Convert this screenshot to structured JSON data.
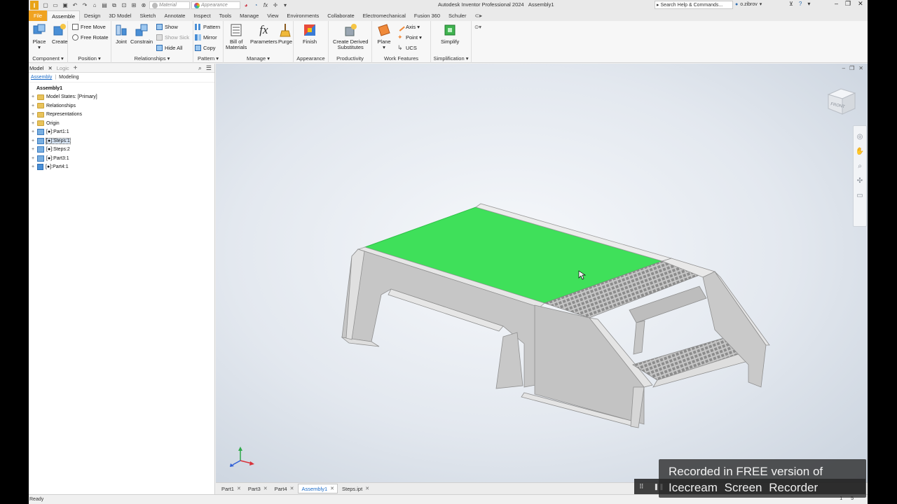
{
  "window": {
    "app_title": "Autodesk Inventor Professional 2024",
    "doc_title": "Assembly1",
    "app_logo": "I"
  },
  "quick_access": {
    "material_label": "Material",
    "appearance_label": "Appearance",
    "fx_label": "fx"
  },
  "search": {
    "placeholder": "Search Help & Commands..."
  },
  "user": {
    "name": "o.zibrov"
  },
  "tabs": [
    {
      "label": "File"
    },
    {
      "label": "Assemble"
    },
    {
      "label": "Design"
    },
    {
      "label": "3D Model"
    },
    {
      "label": "Sketch"
    },
    {
      "label": "Annotate"
    },
    {
      "label": "Inspect"
    },
    {
      "label": "Tools"
    },
    {
      "label": "Manage"
    },
    {
      "label": "View"
    },
    {
      "label": "Environments"
    },
    {
      "label": "Collaborate"
    },
    {
      "label": "Electromechanical"
    },
    {
      "label": "Fusion 360"
    },
    {
      "label": "Schuler"
    }
  ],
  "ribbon": {
    "component": {
      "label": "Component ▾",
      "place": "Place",
      "create": "Create"
    },
    "position": {
      "label": "Position ▾",
      "free_move": "Free Move",
      "free_rotate": "Free Rotate"
    },
    "relationships": {
      "label": "Relationships ▾",
      "joint": "Joint",
      "constrain": "Constrain",
      "show": "Show",
      "show_sick": "Show Sick",
      "hide_all": "Hide All"
    },
    "pattern": {
      "label": "Pattern ▾",
      "pattern": "Pattern",
      "mirror": "Mirror",
      "copy": "Copy"
    },
    "manage": {
      "label": "Manage ▾",
      "bom_line1": "Bill of",
      "bom_line2": "Materials",
      "parameters": "Parameters",
      "purge": "Purge",
      "fx": "fx"
    },
    "appearance": {
      "label": "Appearance",
      "finish": "Finish"
    },
    "productivity": {
      "label": "Productivity",
      "cds_line1": "Create Derived",
      "cds_line2": "Substitutes"
    },
    "work_features": {
      "label": "Work Features",
      "plane": "Plane",
      "axis": "Axis ▾",
      "point": "Point ▾",
      "ucs": "UCS"
    },
    "simplification": {
      "label": "Simplification ▾",
      "simplify": "Simplify"
    }
  },
  "browser": {
    "tabs": [
      {
        "label": "Model"
      },
      {
        "label": "Logic"
      }
    ],
    "sub_tabs": [
      {
        "label": "Assembly"
      },
      {
        "label": "Modeling"
      }
    ],
    "root": "Assembly1",
    "items": [
      {
        "label": "Model States: [Primary]",
        "icon": "folder-icon"
      },
      {
        "label": "Relationships",
        "icon": "folder-icon"
      },
      {
        "label": "Representations",
        "icon": "folder-icon"
      },
      {
        "label": "Origin",
        "icon": "folder-icon"
      },
      {
        "label": "[●]:Part1:1",
        "icon": "part-icon"
      },
      {
        "label": "[●]:Steps:1",
        "icon": "part-icon",
        "selected": true
      },
      {
        "label": "[●]:Steps:2",
        "icon": "part-icon"
      },
      {
        "label": "[●]:Part3:1",
        "icon": "part-icon"
      },
      {
        "label": "[●]:Part4:1",
        "icon": "part-icon"
      }
    ]
  },
  "viewcube": {
    "face_label": "FRONT"
  },
  "doc_tabs": [
    {
      "label": "Part1"
    },
    {
      "label": "Part3"
    },
    {
      "label": "Part4"
    },
    {
      "label": "Assembly1",
      "active": true
    },
    {
      "label": "Steps.ipt"
    }
  ],
  "status": {
    "text": "Ready",
    "count_a": "1",
    "count_b": "5"
  },
  "watermark": {
    "line1": "Recorded in FREE version of",
    "line2": "Icecream Screen Recorder"
  },
  "colors": {
    "file_tab": "#f0a321",
    "selection_green": "#3fe05a",
    "active_tab_text": "#1a6ac7"
  }
}
